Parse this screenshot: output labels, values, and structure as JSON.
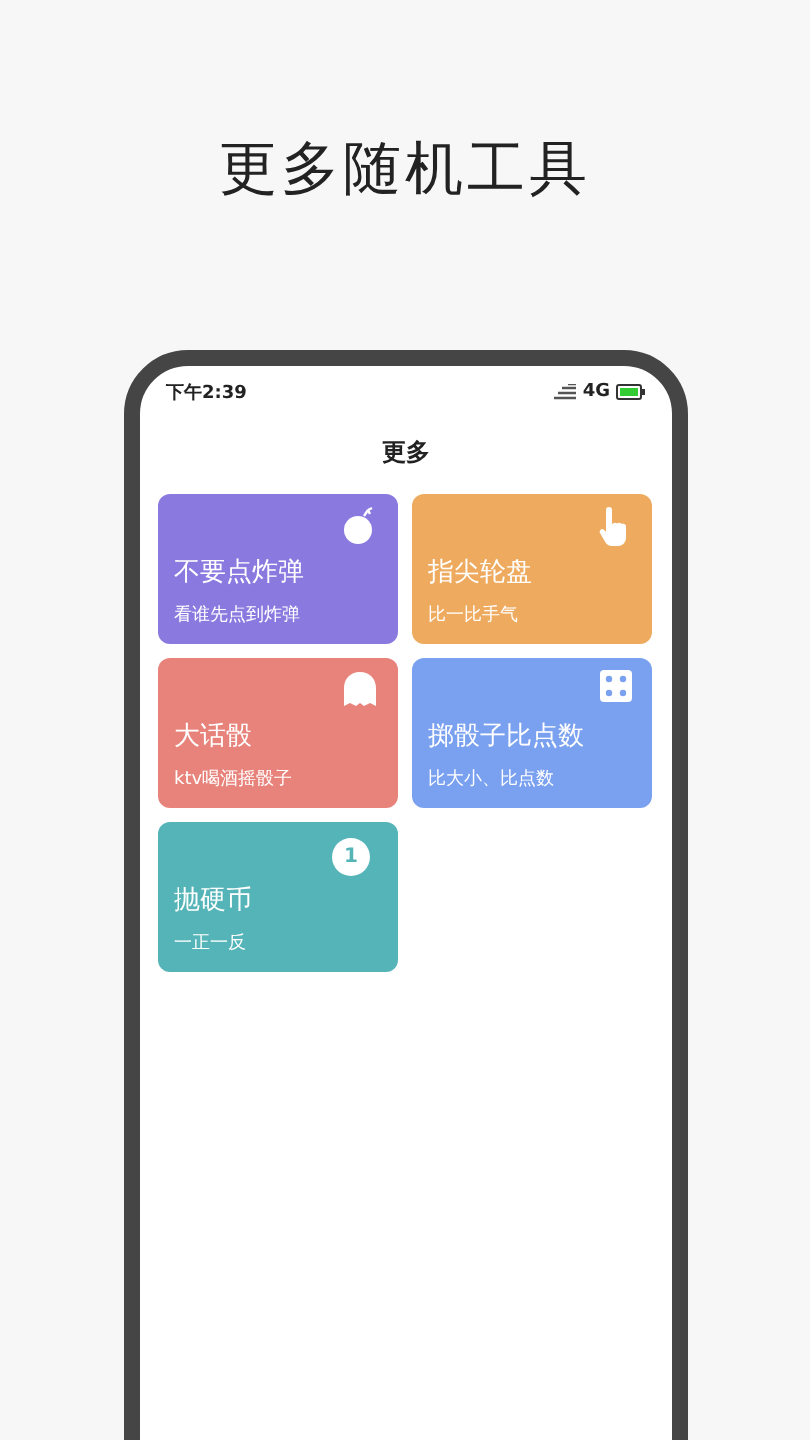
{
  "headline": "更多随机工具",
  "status_bar": {
    "time": "下午2:39",
    "network": "4G"
  },
  "title": "更多",
  "tools": [
    {
      "kind": "bomb",
      "name": "不要点炸弹",
      "desc": "看谁先点到炸弹",
      "color": "#8a7ae0"
    },
    {
      "kind": "hand",
      "name": "指尖轮盘",
      "desc": "比一比手气",
      "color": "#eeaa5e"
    },
    {
      "kind": "bubble",
      "name": "大话骰",
      "desc": "ktv喝酒摇骰子",
      "color": "#e7837a"
    },
    {
      "kind": "dice",
      "name": "掷骰子比点数",
      "desc": "比大小、比点数",
      "color": "#7aa0f0"
    },
    {
      "kind": "coin",
      "name": "抛硬币",
      "desc": "一正一反",
      "color": "#55b4b7",
      "badge": "1"
    }
  ]
}
